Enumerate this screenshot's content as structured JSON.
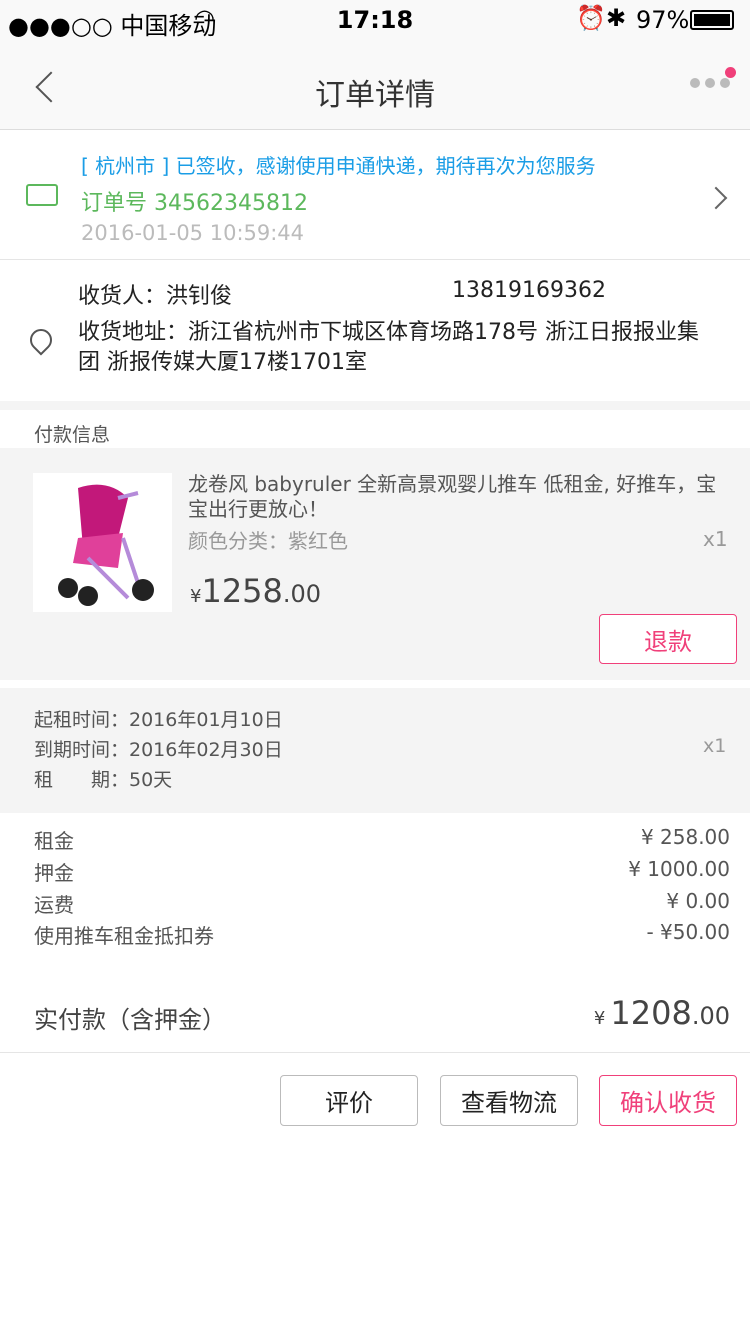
{
  "status": {
    "carrier": "●●●○○ 中国移动",
    "time": "17:18",
    "battery": "97%"
  },
  "header": {
    "title": "订单详情"
  },
  "logistics": {
    "message": "[ 杭州市 ] 已签收，感谢使用申通快递，期待再次为您服务",
    "order_no": "订单号 34562345812",
    "datetime": "2016-01-05  10:59:44"
  },
  "address": {
    "receiver": "收货人：洪钊俊",
    "phone": "13819169362",
    "address": "收货地址：浙江省杭州市下城区体育场路178号  浙江日报报业集团  浙报传媒大厦17楼1701室"
  },
  "payment": {
    "section_title": "付款信息"
  },
  "product": {
    "title": "龙卷风 babyruler  全新高景观婴儿推车 低租金, 好推车，宝宝出行更放心！",
    "spec": "颜色分类：紫红色",
    "qty": "x1",
    "currency": "¥",
    "price_int": "1258",
    "price_dec": ".00",
    "refund_label": "退款"
  },
  "rental": {
    "start": "起租时间：2016年01月10日",
    "end": "到期时间：2016年02月30日",
    "period": "租　　期：50天",
    "qty": "x1"
  },
  "fees": [
    {
      "label": "租金",
      "value": "¥ 258.00"
    },
    {
      "label": "押金",
      "value": "¥ 1000.00"
    },
    {
      "label": "运费",
      "value": "¥ 0.00"
    },
    {
      "label": "使用推车租金抵扣券",
      "value": "- ¥50.00"
    }
  ],
  "total": {
    "label": "实付款（含押金）",
    "currency": "¥",
    "int": "1208",
    "dec": ".00"
  },
  "actions": {
    "review": "评价",
    "logistics": "查看物流",
    "confirm": "确认收货"
  },
  "colors": {
    "accent": "#f0407a",
    "blue": "#1a9de6",
    "green": "#5cb85c"
  }
}
